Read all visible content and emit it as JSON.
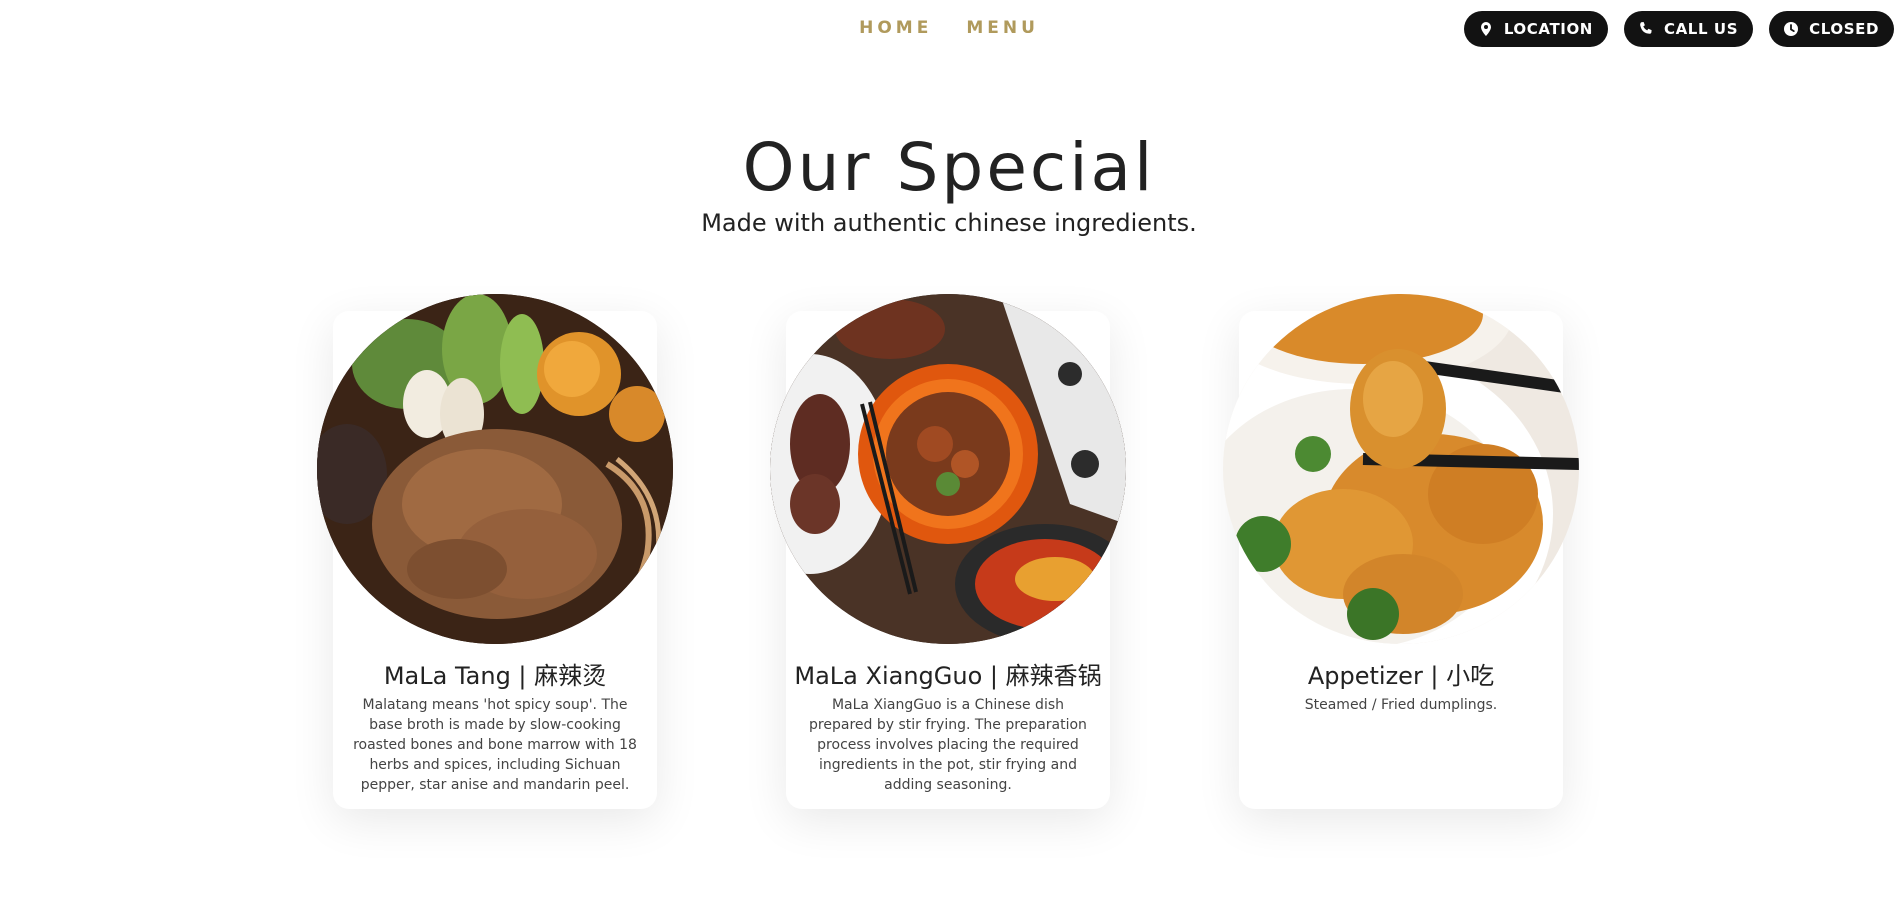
{
  "nav": {
    "links": [
      "HOME",
      "MENU"
    ],
    "buttons": [
      {
        "label": "LOCATION",
        "icon": "map-pin-icon"
      },
      {
        "label": "CALL US",
        "icon": "phone-icon"
      },
      {
        "label": "CLOSED",
        "icon": "clock-icon"
      }
    ]
  },
  "section": {
    "title": "Our Special",
    "subtitle": "Made with authentic chinese ingredients."
  },
  "dishes": [
    {
      "title": "MaLa Tang | 麻辣烫",
      "description": "Malatang means 'hot spicy soup'. The base broth is made by slow-cooking roasted bones and bone marrow with 18 herbs and spices, including Sichuan pepper, star anise and mandarin peel.",
      "image": "mala-tang-bowl-photo"
    },
    {
      "title": "MaLa XiangGuo | 麻辣香锅",
      "description": "MaLa XiangGuo is a Chinese dish prepared by stir frying. The preparation process involves placing the required ingredients in the pot, stir frying and adding seasoning.",
      "image": "mala-xiangguo-platter-photo"
    },
    {
      "title": "Appetizer | 小吃",
      "description": "Steamed / Fried dumplings.",
      "image": "sesame-chicken-chopsticks-photo"
    }
  ],
  "colors": {
    "nav_link": "#b09a5c",
    "pill_background": "#121212",
    "text": "#222222"
  }
}
